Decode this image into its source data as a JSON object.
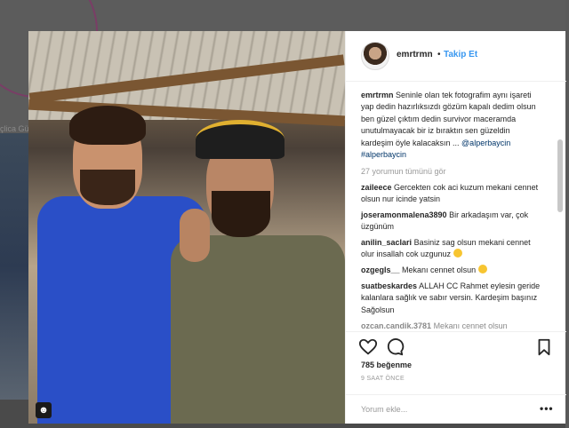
{
  "background": {
    "partial_text": "çlica Gü"
  },
  "post": {
    "username": "emrtrmn",
    "separator": "•",
    "follow_label": "Takip Et",
    "caption_user": "emrtrmn",
    "caption_text": "Seninle olan tek fotografim aynı işareti yap dedin hazırlıksızdı gözüm kapalı dedim olsun ben güzel çıktım dedin survivor maceramda unutulmayacak bir iz bıraktın sen güzeldin kardeşim öyle kalacaksın ... ",
    "caption_tags": "@alperbaycin #alperbaycin",
    "view_all": "27 yorumun tümünü gör",
    "comments": [
      {
        "user": "zaileece",
        "text": "Gercekten cok aci kuzum mekani cennet olsun nur icinde yatsin",
        "emoji": false
      },
      {
        "user": "joseramonmalena3890",
        "text": "Bir arkadaşım var, çok üzgünüm",
        "emoji": false
      },
      {
        "user": "anilin_saclari",
        "text": "Basiniz sag olsun mekani cennet olur insallah cok uzgunuz",
        "emoji": true
      },
      {
        "user": "ozgegls__",
        "text": "Mekanı cennet olsun",
        "emoji": true
      },
      {
        "user": "suatbeskardes",
        "text": "ALLAH CC Rahmet eylesin geride kalanlara sağlık ve sabır versin. Kardeşim başınız Sağolsun",
        "emoji": false
      },
      {
        "user": "ozcan.candik.3781",
        "text": "Mekanı cennet olsun",
        "emoji": false
      }
    ],
    "likes": "785 beğenme",
    "time": "9 SAAT ÖNCE",
    "add_comment_placeholder": "Yorum ekle...",
    "more_label": "•••"
  },
  "icons": {
    "like": "heart-icon",
    "comment": "comment-bubble-icon",
    "save": "bookmark-icon",
    "tagged": "user-tag-icon"
  },
  "colors": {
    "link": "#3897f0",
    "tag": "#003569",
    "muted": "#999999"
  }
}
